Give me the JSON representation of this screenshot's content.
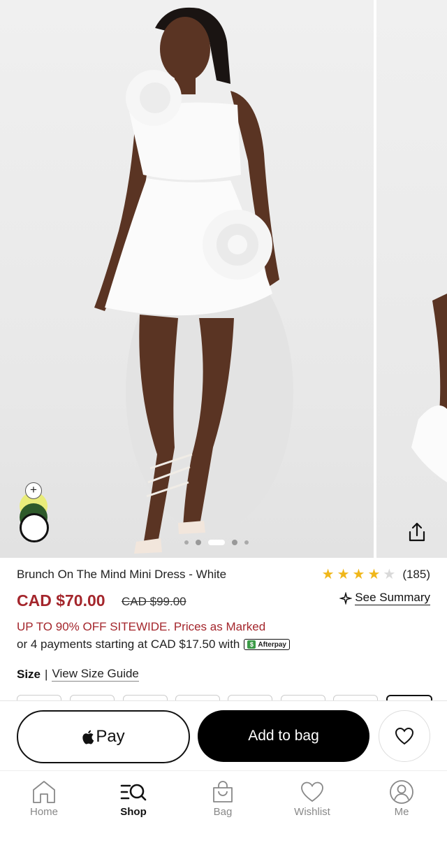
{
  "product": {
    "title": "Brunch On The Mind Mini Dress - White",
    "rating_stars": 4.5,
    "review_count": "(185)",
    "price": "CAD $70.00",
    "old_price": "CAD $99.00",
    "see_summary": "See Summary",
    "promo": "UP TO 90% OFF SITEWIDE. Prices as Marked",
    "payments_text": "or 4 payments starting at CAD $17.50 with",
    "afterpay_label": "Afterpay",
    "size_label": "Size",
    "size_guide": "View Size Guide"
  },
  "gallery": {
    "swatch_add": "+",
    "swatches": [
      "yellow",
      "green",
      "white"
    ],
    "selected_swatch": "white",
    "image_count": 5,
    "active_image": 3
  },
  "actions": {
    "apple_pay": "Pay",
    "add_to_bag": "Add to bag"
  },
  "tabs": [
    {
      "label": "Home",
      "icon": "home-icon"
    },
    {
      "label": "Shop",
      "icon": "shop-search-icon"
    },
    {
      "label": "Bag",
      "icon": "bag-icon"
    },
    {
      "label": "Wishlist",
      "icon": "heart-icon"
    },
    {
      "label": "Me",
      "icon": "user-icon"
    }
  ],
  "active_tab": "Shop",
  "colors": {
    "price_red": "#a4262c",
    "star_gold": "#f0b71a",
    "button_black": "#000000"
  }
}
